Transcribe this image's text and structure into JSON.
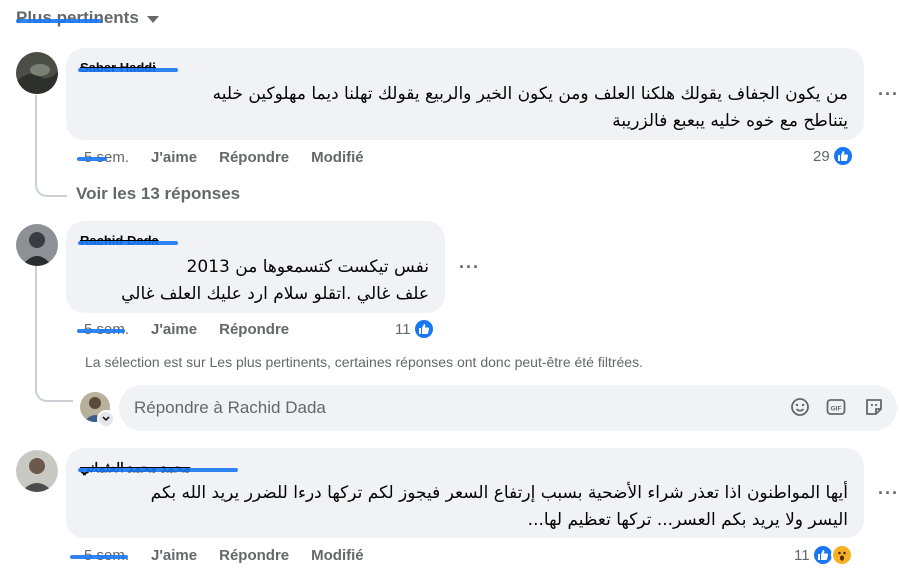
{
  "sort": {
    "label": "Plus pertinents"
  },
  "comments": [
    {
      "author": "Saber Haddi",
      "lines": [
        "من يكون الجفاف يقولك هلكنا العلف ومن يكون الخير والربيع يقولك تهلنا ديما مهلوكين خليه",
        "يتناطح مع خوه خليه يبعبع فالزريبة"
      ],
      "time": "5 sem.",
      "like": "J'aime",
      "reply": "Répondre",
      "edited": "Modifié",
      "reactions": "29"
    },
    {
      "author": "Rachid Dada",
      "lines": [
        "نفس تيكست كتسمعوها من 2013",
        "علف غالي .اتقلو سلام ارد عليك العلف غالي"
      ],
      "time": "5 sem.",
      "like": "J'aime",
      "reply": "Répondre",
      "reactions": "11"
    },
    {
      "author": "محمد محمد العثماني",
      "lines": [
        "أيها المواطنون اذا تعذر شراء الأضحية بسبب إرتفاع السعر فيجوز لكم تركها درءا للضرر يريد الله بكم",
        "اليسر ولا يريد بكم العسر... تركها تعظيم لها..."
      ],
      "time": "5 sem.",
      "like": "J'aime",
      "reply": "Répondre",
      "edited": "Modifié",
      "reactions": "11"
    }
  ],
  "thread": {
    "view_replies": "Voir les 13 réponses"
  },
  "notice": "La sélection est sur Les plus pertinents, certaines réponses ont donc peut-être été filtrées.",
  "reply_box": {
    "placeholder": "Répondre à Rachid Dada"
  },
  "colors": {
    "accent": "#1877f2",
    "bubble": "#f0f2f5",
    "muted": "#65676b"
  }
}
